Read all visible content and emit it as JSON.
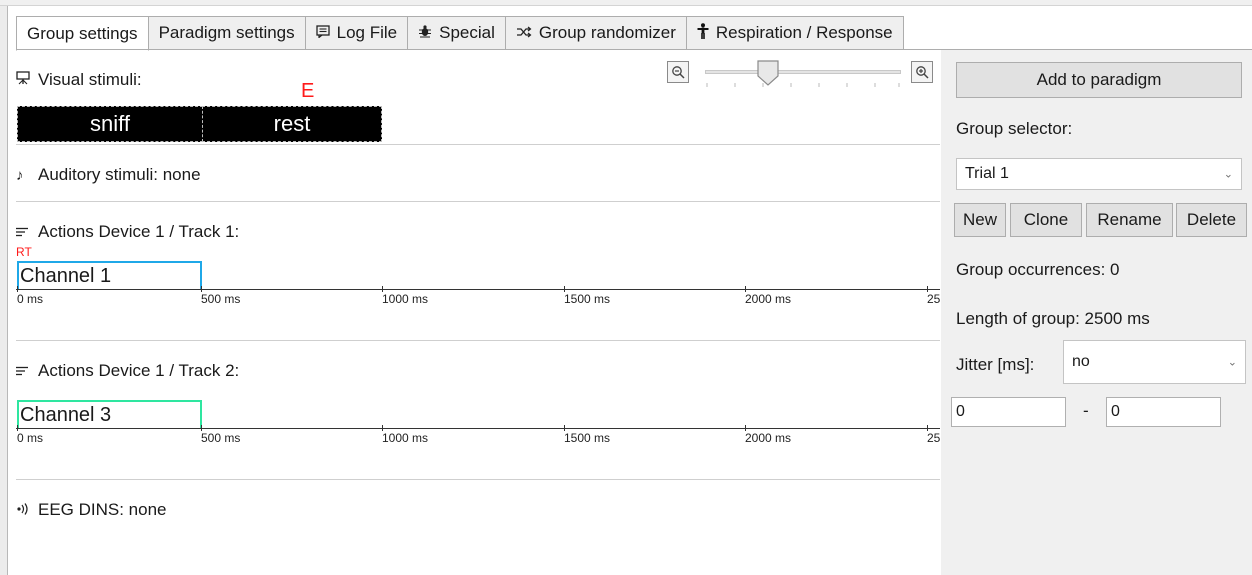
{
  "tabs": [
    {
      "label": "Group settings",
      "icon": "",
      "active": true
    },
    {
      "label": "Paradigm settings",
      "icon": "",
      "active": false
    },
    {
      "label": "Log File",
      "icon": "log-icon",
      "active": false
    },
    {
      "label": "Special",
      "icon": "bug-icon",
      "active": false
    },
    {
      "label": "Group randomizer",
      "icon": "shuffle-icon",
      "active": false
    },
    {
      "label": "Respiration / Response",
      "icon": "person-icon",
      "active": false
    }
  ],
  "visual": {
    "title": "Visual stimuli:",
    "marker": "E",
    "stimuli": [
      {
        "label": "sniff"
      },
      {
        "label": "rest"
      }
    ]
  },
  "auditory": {
    "title": "Auditory stimuli: none"
  },
  "track1": {
    "title": "Actions Device 1 / Track 1:",
    "marker": "RT",
    "channel": "Channel 1",
    "color": "#1fa8e8"
  },
  "track2": {
    "title": "Actions Device 1 / Track 2:",
    "channel": "Channel 3",
    "color": "#2ee6a0"
  },
  "timeline": {
    "ticks": [
      "0 ms",
      "500 ms",
      "1000 ms",
      "1500 ms",
      "2000 ms",
      "25"
    ]
  },
  "eeg": {
    "title": "EEG DINS: none"
  },
  "panel": {
    "add_button": "Add to paradigm",
    "group_selector_label": "Group selector:",
    "group_selected": "Trial 1",
    "buttons": {
      "new": "New",
      "clone": "Clone",
      "rename": "Rename",
      "delete": "Delete"
    },
    "occurrences": "Group occurrences:  0",
    "length": "Length of group:  2500 ms",
    "jitter_label": "Jitter [ms]:",
    "jitter_value": "no",
    "range_from": "0",
    "range_sep": "-",
    "range_to": "0"
  },
  "colors": {
    "marker": "#ff1a1a",
    "stimulus_bg": "#000000"
  }
}
